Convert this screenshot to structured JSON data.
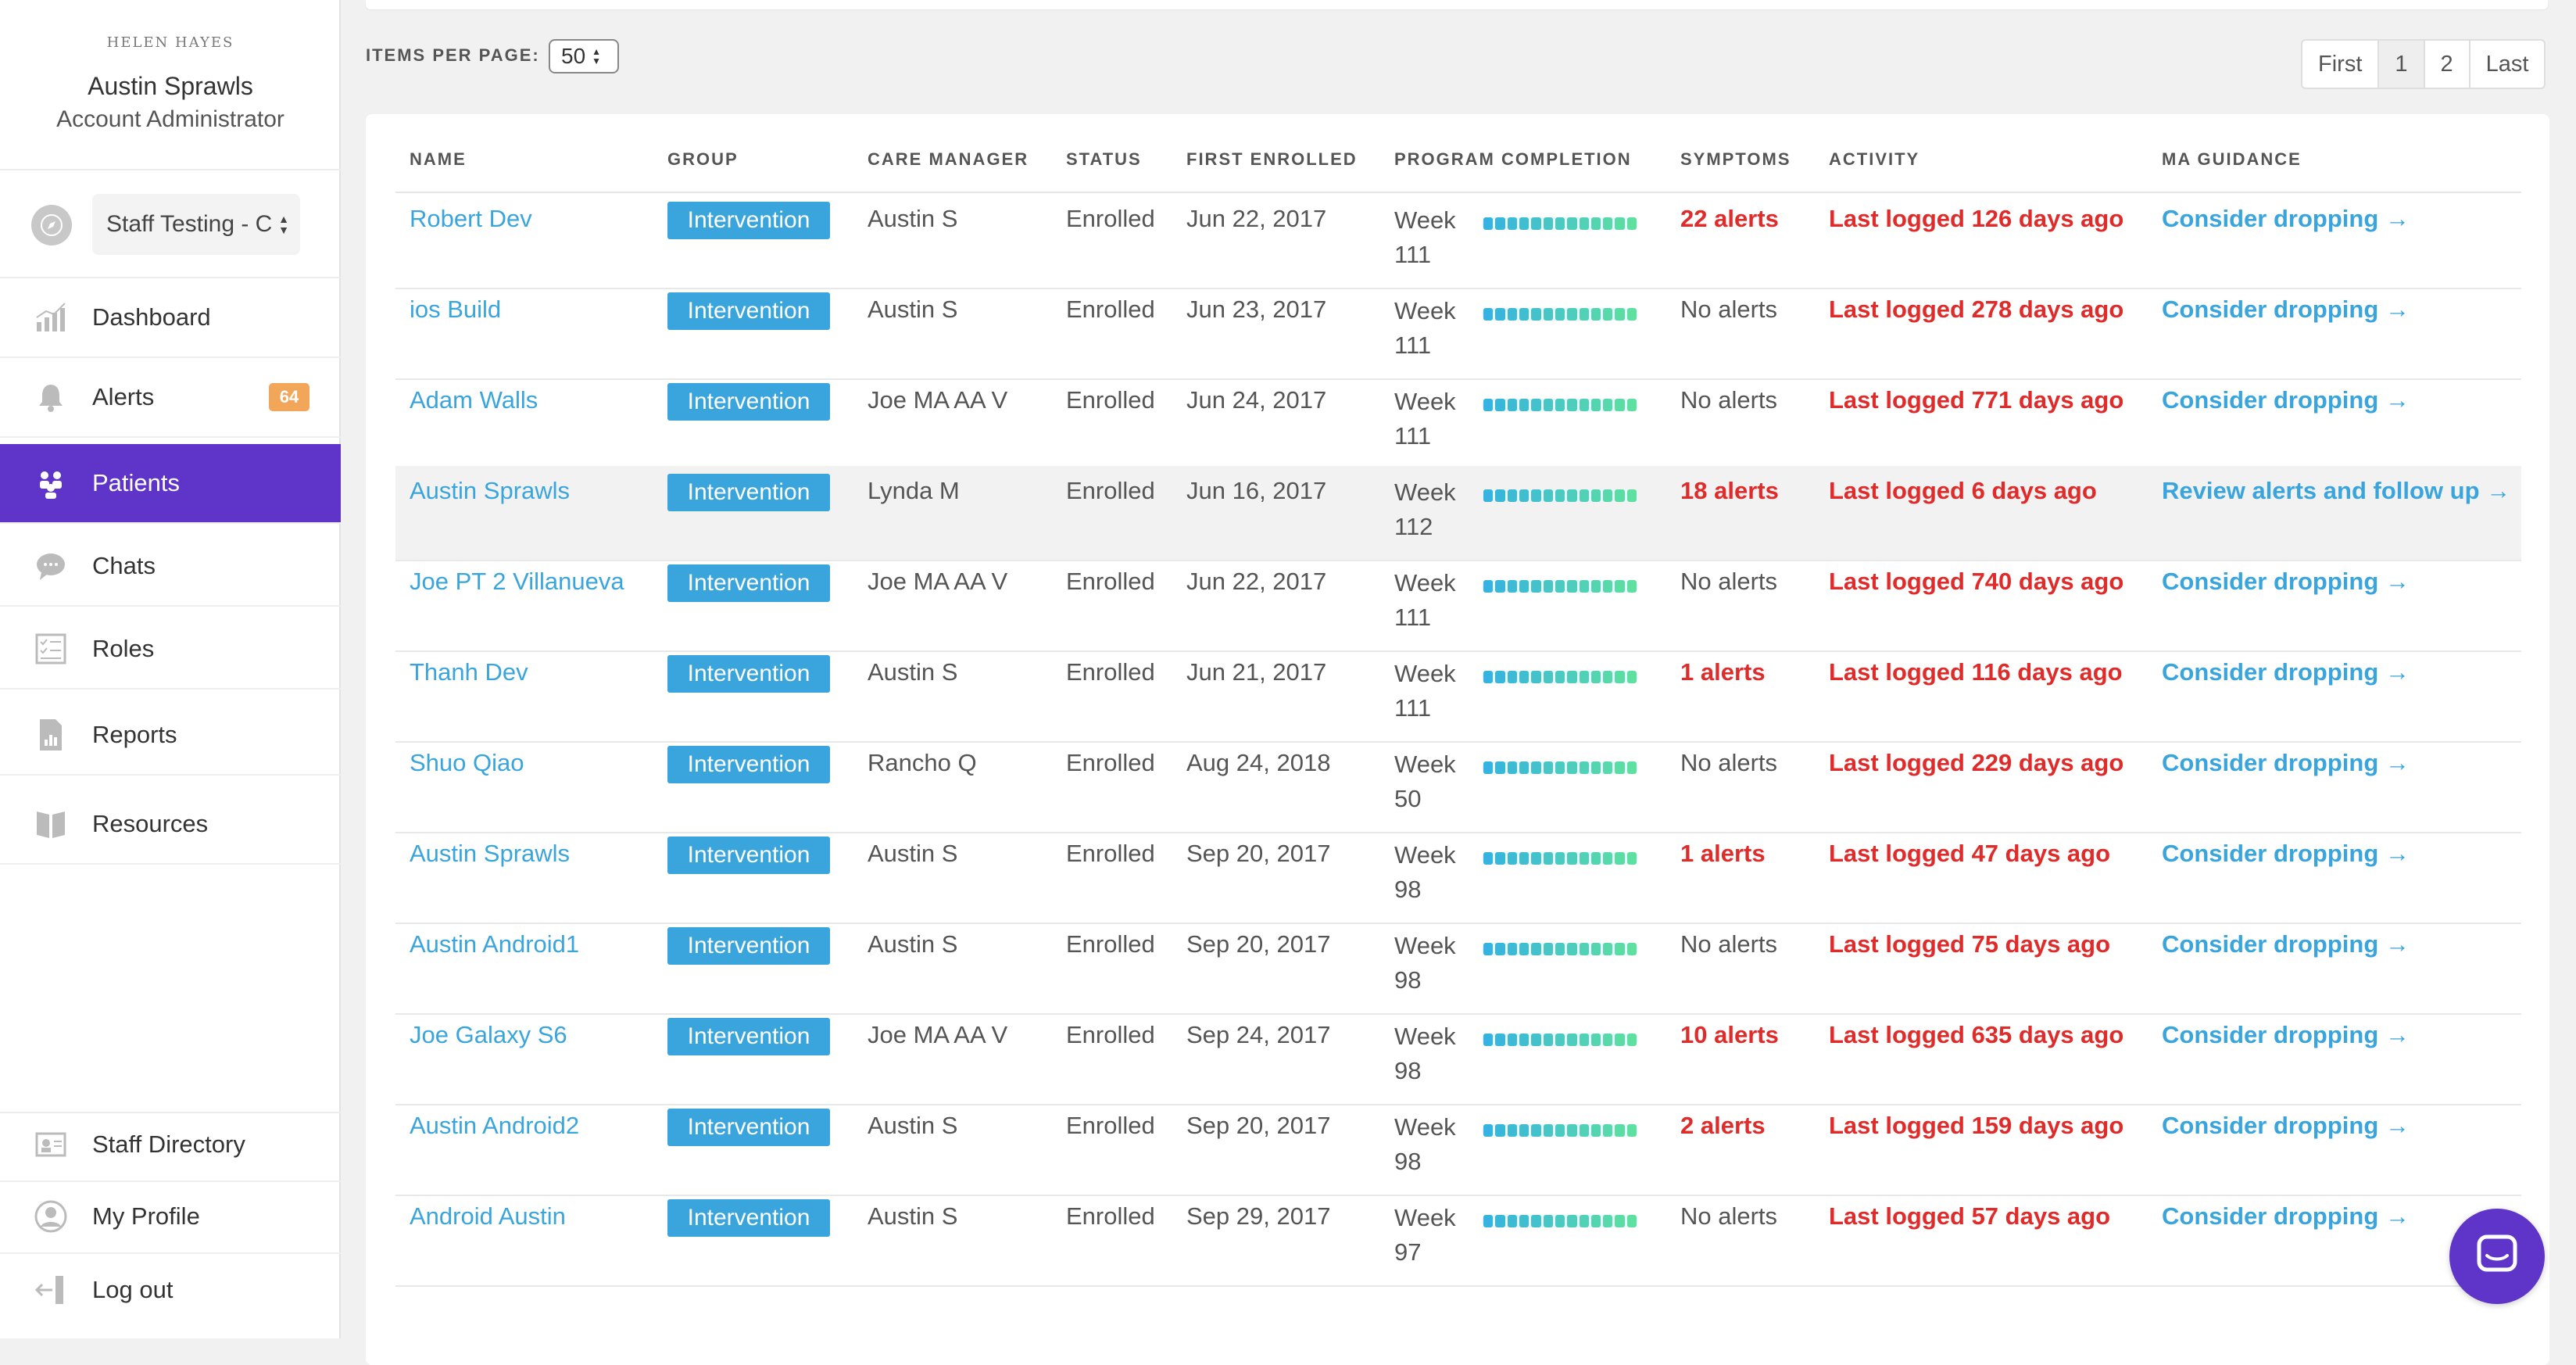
{
  "sidebar": {
    "logo": "HELEN HAYES",
    "user_name": "Austin Sprawls",
    "user_role": "Account Administrator",
    "selector_value": "Staff Testing - C",
    "nav": [
      {
        "label": "Dashboard",
        "icon": "chart-icon"
      },
      {
        "label": "Alerts",
        "icon": "bell-icon",
        "badge": "64"
      },
      {
        "label": "Patients",
        "icon": "patients-icon",
        "active": true
      },
      {
        "label": "Chats",
        "icon": "chat-icon"
      },
      {
        "label": "Roles",
        "icon": "roles-icon"
      },
      {
        "label": "Reports",
        "icon": "report-icon"
      },
      {
        "label": "Resources",
        "icon": "book-icon"
      }
    ],
    "bottom": [
      {
        "label": "Staff Directory",
        "icon": "directory-icon"
      },
      {
        "label": "My Profile",
        "icon": "profile-icon"
      },
      {
        "label": "Log out",
        "icon": "logout-icon"
      }
    ]
  },
  "toolbar": {
    "items_per_page_label": "ITEMS PER PAGE:",
    "items_per_page_value": "50",
    "pager": [
      "First",
      "1",
      "2",
      "Last"
    ]
  },
  "table": {
    "headers": [
      "NAME",
      "GROUP",
      "CARE MANAGER",
      "STATUS",
      "FIRST ENROLLED",
      "PROGRAM COMPLETION",
      "SYMPTOMS",
      "ACTIVITY",
      "MA GUIDANCE"
    ],
    "rows": [
      {
        "name": "Robert Dev",
        "group": "Intervention",
        "manager": "Austin S",
        "status": "Enrolled",
        "enrolled": "Jun 22, 2017",
        "week_label": "Week",
        "week_num": "111",
        "symptoms": "22 alerts",
        "activity": "Last logged 126 days ago",
        "guidance": "Consider dropping →"
      },
      {
        "name": "ios Build",
        "group": "Intervention",
        "manager": "Austin S",
        "status": "Enrolled",
        "enrolled": "Jun 23, 2017",
        "week_label": "Week",
        "week_num": "111",
        "symptoms": "No alerts",
        "activity": "Last logged 278 days ago",
        "guidance": "Consider dropping →"
      },
      {
        "name": "Adam Walls",
        "group": "Intervention",
        "manager": "Joe MA AA V",
        "status": "Enrolled",
        "enrolled": "Jun 24, 2017",
        "week_label": "Week",
        "week_num": "111",
        "symptoms": "No alerts",
        "activity": "Last logged 771 days ago",
        "guidance": "Consider dropping →"
      },
      {
        "name": "Austin Sprawls",
        "group": "Intervention",
        "manager": "Lynda M",
        "status": "Enrolled",
        "enrolled": "Jun 16, 2017",
        "week_label": "Week",
        "week_num": "112",
        "symptoms": "18 alerts",
        "activity": "Last logged 6 days ago",
        "guidance": "Review alerts and follow up →"
      },
      {
        "name": "Joe PT 2 Villanueva",
        "group": "Intervention",
        "manager": "Joe MA AA V",
        "status": "Enrolled",
        "enrolled": "Jun 22, 2017",
        "week_label": "Week",
        "week_num": "111",
        "symptoms": "No alerts",
        "activity": "Last logged 740 days ago",
        "guidance": "Consider dropping →"
      },
      {
        "name": "Thanh Dev",
        "group": "Intervention",
        "manager": "Austin S",
        "status": "Enrolled",
        "enrolled": "Jun 21, 2017",
        "week_label": "Week",
        "week_num": "111",
        "symptoms": "1 alerts",
        "activity": "Last logged 116 days ago",
        "guidance": "Consider dropping →"
      },
      {
        "name": "Shuo Qiao",
        "group": "Intervention",
        "manager": "Rancho Q",
        "status": "Enrolled",
        "enrolled": "Aug 24, 2018",
        "week_label": "Week",
        "week_num": "50",
        "symptoms": "No alerts",
        "activity": "Last logged 229 days ago",
        "guidance": "Consider dropping →"
      },
      {
        "name": "Austin Sprawls",
        "group": "Intervention",
        "manager": "Austin S",
        "status": "Enrolled",
        "enrolled": "Sep 20, 2017",
        "week_label": "Week",
        "week_num": "98",
        "symptoms": "1 alerts",
        "activity": "Last logged 47 days ago",
        "guidance": "Consider dropping →"
      },
      {
        "name": "Austin Android1",
        "group": "Intervention",
        "manager": "Austin S",
        "status": "Enrolled",
        "enrolled": "Sep 20, 2017",
        "week_label": "Week",
        "week_num": "98",
        "symptoms": "No alerts",
        "activity": "Last logged 75 days ago",
        "guidance": "Consider dropping →"
      },
      {
        "name": "Joe Galaxy S6",
        "group": "Intervention",
        "manager": "Joe MA AA V",
        "status": "Enrolled",
        "enrolled": "Sep 24, 2017",
        "week_label": "Week",
        "week_num": "98",
        "symptoms": "10 alerts",
        "activity": "Last logged 635 days ago",
        "guidance": "Consider dropping →"
      },
      {
        "name": "Austin Android2",
        "group": "Intervention",
        "manager": "Austin S",
        "status": "Enrolled",
        "enrolled": "Sep 20, 2017",
        "week_label": "Week",
        "week_num": "98",
        "symptoms": "2 alerts",
        "activity": "Last logged 159 days ago",
        "guidance": "Consider dropping →"
      },
      {
        "name": "Android Austin",
        "group": "Intervention",
        "manager": "Austin S",
        "status": "Enrolled",
        "enrolled": "Sep 29, 2017",
        "week_label": "Week",
        "week_num": "97",
        "symptoms": "No alerts",
        "activity": "Last logged 57 days ago",
        "guidance": "Consider dropping →"
      }
    ]
  },
  "colors": {
    "accent": "#5e35c8",
    "link": "#3aa5dc",
    "alert": "#e02b2b",
    "badge": "#f2a65a",
    "progress_start": "#36b3e0",
    "progress_end": "#5ee0a0"
  },
  "widgets": {
    "chat_launcher_icon": "messenger-icon"
  }
}
